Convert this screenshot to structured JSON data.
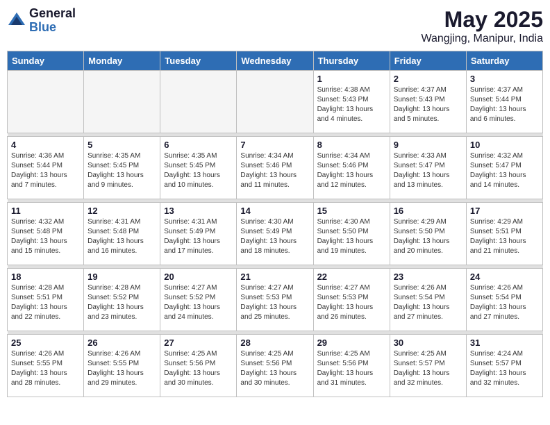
{
  "header": {
    "logo_general": "General",
    "logo_blue": "Blue",
    "month_year": "May 2025",
    "location": "Wangjing, Manipur, India"
  },
  "weekdays": [
    "Sunday",
    "Monday",
    "Tuesday",
    "Wednesday",
    "Thursday",
    "Friday",
    "Saturday"
  ],
  "weeks": [
    [
      {
        "day": "",
        "info": ""
      },
      {
        "day": "",
        "info": ""
      },
      {
        "day": "",
        "info": ""
      },
      {
        "day": "",
        "info": ""
      },
      {
        "day": "1",
        "info": "Sunrise: 4:38 AM\nSunset: 5:43 PM\nDaylight: 13 hours\nand 4 minutes."
      },
      {
        "day": "2",
        "info": "Sunrise: 4:37 AM\nSunset: 5:43 PM\nDaylight: 13 hours\nand 5 minutes."
      },
      {
        "day": "3",
        "info": "Sunrise: 4:37 AM\nSunset: 5:44 PM\nDaylight: 13 hours\nand 6 minutes."
      }
    ],
    [
      {
        "day": "4",
        "info": "Sunrise: 4:36 AM\nSunset: 5:44 PM\nDaylight: 13 hours\nand 7 minutes."
      },
      {
        "day": "5",
        "info": "Sunrise: 4:35 AM\nSunset: 5:45 PM\nDaylight: 13 hours\nand 9 minutes."
      },
      {
        "day": "6",
        "info": "Sunrise: 4:35 AM\nSunset: 5:45 PM\nDaylight: 13 hours\nand 10 minutes."
      },
      {
        "day": "7",
        "info": "Sunrise: 4:34 AM\nSunset: 5:46 PM\nDaylight: 13 hours\nand 11 minutes."
      },
      {
        "day": "8",
        "info": "Sunrise: 4:34 AM\nSunset: 5:46 PM\nDaylight: 13 hours\nand 12 minutes."
      },
      {
        "day": "9",
        "info": "Sunrise: 4:33 AM\nSunset: 5:47 PM\nDaylight: 13 hours\nand 13 minutes."
      },
      {
        "day": "10",
        "info": "Sunrise: 4:32 AM\nSunset: 5:47 PM\nDaylight: 13 hours\nand 14 minutes."
      }
    ],
    [
      {
        "day": "11",
        "info": "Sunrise: 4:32 AM\nSunset: 5:48 PM\nDaylight: 13 hours\nand 15 minutes."
      },
      {
        "day": "12",
        "info": "Sunrise: 4:31 AM\nSunset: 5:48 PM\nDaylight: 13 hours\nand 16 minutes."
      },
      {
        "day": "13",
        "info": "Sunrise: 4:31 AM\nSunset: 5:49 PM\nDaylight: 13 hours\nand 17 minutes."
      },
      {
        "day": "14",
        "info": "Sunrise: 4:30 AM\nSunset: 5:49 PM\nDaylight: 13 hours\nand 18 minutes."
      },
      {
        "day": "15",
        "info": "Sunrise: 4:30 AM\nSunset: 5:50 PM\nDaylight: 13 hours\nand 19 minutes."
      },
      {
        "day": "16",
        "info": "Sunrise: 4:29 AM\nSunset: 5:50 PM\nDaylight: 13 hours\nand 20 minutes."
      },
      {
        "day": "17",
        "info": "Sunrise: 4:29 AM\nSunset: 5:51 PM\nDaylight: 13 hours\nand 21 minutes."
      }
    ],
    [
      {
        "day": "18",
        "info": "Sunrise: 4:28 AM\nSunset: 5:51 PM\nDaylight: 13 hours\nand 22 minutes."
      },
      {
        "day": "19",
        "info": "Sunrise: 4:28 AM\nSunset: 5:52 PM\nDaylight: 13 hours\nand 23 minutes."
      },
      {
        "day": "20",
        "info": "Sunrise: 4:27 AM\nSunset: 5:52 PM\nDaylight: 13 hours\nand 24 minutes."
      },
      {
        "day": "21",
        "info": "Sunrise: 4:27 AM\nSunset: 5:53 PM\nDaylight: 13 hours\nand 25 minutes."
      },
      {
        "day": "22",
        "info": "Sunrise: 4:27 AM\nSunset: 5:53 PM\nDaylight: 13 hours\nand 26 minutes."
      },
      {
        "day": "23",
        "info": "Sunrise: 4:26 AM\nSunset: 5:54 PM\nDaylight: 13 hours\nand 27 minutes."
      },
      {
        "day": "24",
        "info": "Sunrise: 4:26 AM\nSunset: 5:54 PM\nDaylight: 13 hours\nand 27 minutes."
      }
    ],
    [
      {
        "day": "25",
        "info": "Sunrise: 4:26 AM\nSunset: 5:55 PM\nDaylight: 13 hours\nand 28 minutes."
      },
      {
        "day": "26",
        "info": "Sunrise: 4:26 AM\nSunset: 5:55 PM\nDaylight: 13 hours\nand 29 minutes."
      },
      {
        "day": "27",
        "info": "Sunrise: 4:25 AM\nSunset: 5:56 PM\nDaylight: 13 hours\nand 30 minutes."
      },
      {
        "day": "28",
        "info": "Sunrise: 4:25 AM\nSunset: 5:56 PM\nDaylight: 13 hours\nand 30 minutes."
      },
      {
        "day": "29",
        "info": "Sunrise: 4:25 AM\nSunset: 5:56 PM\nDaylight: 13 hours\nand 31 minutes."
      },
      {
        "day": "30",
        "info": "Sunrise: 4:25 AM\nSunset: 5:57 PM\nDaylight: 13 hours\nand 32 minutes."
      },
      {
        "day": "31",
        "info": "Sunrise: 4:24 AM\nSunset: 5:57 PM\nDaylight: 13 hours\nand 32 minutes."
      }
    ]
  ]
}
